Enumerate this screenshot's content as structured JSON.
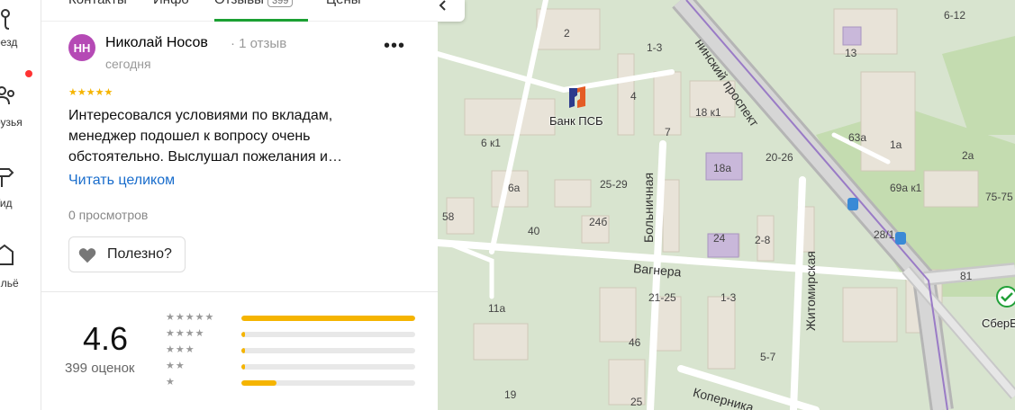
{
  "rail": {
    "items": [
      {
        "label": "оезд",
        "icon": "route-icon"
      },
      {
        "label": "рузья",
        "icon": "friends-icon"
      },
      {
        "label": "Гид",
        "icon": "guide-icon"
      },
      {
        "label": "ильё",
        "icon": "housing-icon"
      }
    ],
    "notification_color": "#ff3333"
  },
  "tabs": [
    {
      "label": "Контакты"
    },
    {
      "label": "Инфо"
    },
    {
      "label": "Отзывы",
      "badge": "399"
    },
    {
      "label": "Цены"
    }
  ],
  "review": {
    "avatar_initials": "НН",
    "avatar_color": "#b54ab5",
    "author": "Николай Носов",
    "author_meta": "· 1 отзыв",
    "date": "сегодня",
    "more_label": "•••",
    "stars": "★★★★★",
    "text": "Интересовался условиями по вкладам, менеджер подошел к вопросу очень обстоятельно. Выслушал пожелания и…",
    "read_full": "Читать целиком",
    "views": "0 просмотров",
    "useful_label": "Полезно?"
  },
  "summary": {
    "rating": "4.6",
    "count": "399 оценок",
    "distribution": [
      {
        "stars": "★★★★★",
        "fraction": 1.0
      },
      {
        "stars": "★★★★",
        "fraction": 0.02
      },
      {
        "stars": "★★★",
        "fraction": 0.02
      },
      {
        "stars": "★★",
        "fraction": 0.02
      },
      {
        "stars": "★",
        "fraction": 0.2
      }
    ],
    "accent": "#f5b400"
  },
  "map": {
    "streets": [
      "нинский проспект",
      "Больничная",
      "Вагнера",
      "Житомирская",
      "Коперника"
    ],
    "house_numbers": [
      "2",
      "1-3",
      "4",
      "18 к1",
      "63а",
      "1а",
      "6-12",
      "13",
      "6 к1",
      "7",
      "18а",
      "20-26",
      "2а",
      "69а к1",
      "75-75",
      "6а",
      "25-29",
      "24б",
      "58",
      "40",
      "24",
      "2-8",
      "28/1",
      "81",
      "11а",
      "21-25",
      "1-3",
      "46",
      "5-7",
      "19",
      "25"
    ],
    "pois": [
      {
        "name": "Банк ПСБ",
        "icon": "psb-bank-icon"
      },
      {
        "name": "СберБ",
        "icon": "sberbank-icon"
      }
    ]
  }
}
